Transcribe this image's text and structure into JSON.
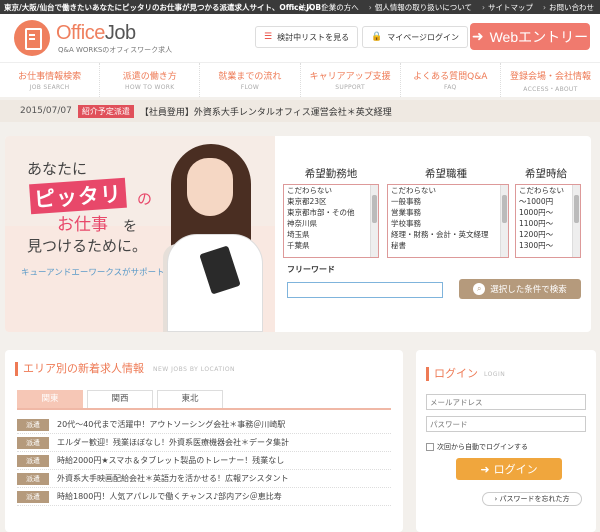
{
  "topbar": {
    "tagline": "東京/大阪/仙台で働きたいあなたにピッタリのお仕事が見つかる派遣求人サイト、Office JOB！",
    "links": [
      "法人・企業の方へ",
      "個人情報の取り扱いについて",
      "サイトマップ",
      "お問い合わせ"
    ]
  },
  "header": {
    "logo_office": "Office",
    "logo_job": "Job",
    "logo_sub": "Q&A WORKSのオフィスワーク求人",
    "list_button": "検討中リストを見る",
    "mypage_button": "マイページログイン",
    "entry_button": "Webエントリー"
  },
  "nav": [
    {
      "jp": "お仕事情報検索",
      "en": "JOB SEARCH"
    },
    {
      "jp": "派遣の働き方",
      "en": "HOW TO WORK"
    },
    {
      "jp": "就業までの流れ",
      "en": "FLOW"
    },
    {
      "jp": "キャリアアップ支援",
      "en": "SUPPORT"
    },
    {
      "jp": "よくある質問Q&A",
      "en": "FAQ"
    },
    {
      "jp": "登録会場・会社情報",
      "en": "ACCESS・ABOUT"
    }
  ],
  "news": {
    "date": "2015/07/07",
    "badge": "紹介予定派遣",
    "text": "【社員登用】外資系大手レンタルオフィス運営会社＊英文経理"
  },
  "hero": {
    "line1": "あなたに",
    "line2": "ピッタリ",
    "line2b": "の",
    "line3": "お仕事",
    "line3b": "を",
    "line4": "見つけるために。",
    "support": "キューアンドエーワークスがサポートします！"
  },
  "search": {
    "location_title": "希望勤務地",
    "job_title": "希望職種",
    "wage_title": "希望時給",
    "locations": [
      "こだわらない",
      "東京都23区",
      "東京都市部・その他",
      "神奈川県",
      "埼玉県",
      "千葉県"
    ],
    "jobs": [
      "こだわらない",
      "一般事務",
      "営業事務",
      "学校事務",
      "経理・財務・会計・英文経理",
      "秘書"
    ],
    "wages": [
      "こだわらない",
      "〜1000円",
      "1000円〜",
      "1100円〜",
      "1200円〜",
      "1300円〜"
    ],
    "freeword_label": "フリーワード",
    "freeword_value": "",
    "button": "選択した条件で検索"
  },
  "area_jobs": {
    "title": "エリア別の新着求人情報",
    "title_en": "NEW JOBS BY LOCATION",
    "tabs": [
      "関東",
      "関西",
      "東北"
    ],
    "rows": [
      {
        "tag": "派遣",
        "text": "20代〜40代まで活躍中！アウトソーシング会社＊事務＠川崎駅"
      },
      {
        "tag": "派遣",
        "text": "エルダー歓迎！残業ほぼなし！外資系医療機器会社＊データ集計"
      },
      {
        "tag": "派遣",
        "text": "時給2000円★スマホ＆タブレット製品のトレーナー！残業なし"
      },
      {
        "tag": "派遣",
        "text": "外資系大手映画配給会社＊英語力を活かせる！広報アシスタント"
      },
      {
        "tag": "派遣",
        "text": "時給1800円！人気アパレルで働くチャンス♪部内アシ＠恵比寿"
      }
    ]
  },
  "login": {
    "title": "ログイン",
    "title_en": "LOGIN",
    "email_placeholder": "メールアドレス",
    "password_placeholder": "パスワード",
    "auto_login": "次回から自動でログインする",
    "button": "ログイン",
    "forgot": "パスワードを忘れた方"
  }
}
